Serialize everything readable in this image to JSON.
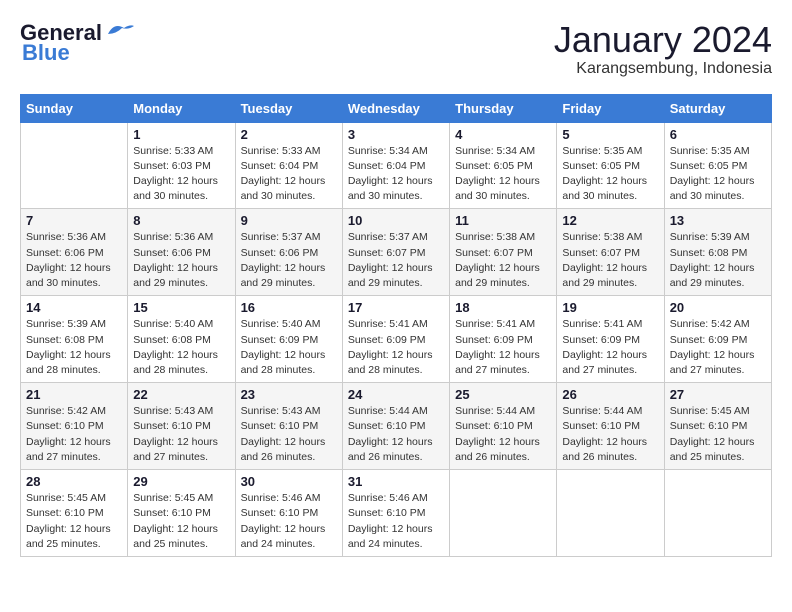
{
  "logo": {
    "general": "General",
    "blue": "Blue",
    "tagline": ""
  },
  "header": {
    "month": "January 2024",
    "location": "Karangsembung, Indonesia"
  },
  "weekdays": [
    "Sunday",
    "Monday",
    "Tuesday",
    "Wednesday",
    "Thursday",
    "Friday",
    "Saturday"
  ],
  "weeks": [
    [
      {
        "day": "",
        "info": ""
      },
      {
        "day": "1",
        "info": "Sunrise: 5:33 AM\nSunset: 6:03 PM\nDaylight: 12 hours\nand 30 minutes."
      },
      {
        "day": "2",
        "info": "Sunrise: 5:33 AM\nSunset: 6:04 PM\nDaylight: 12 hours\nand 30 minutes."
      },
      {
        "day": "3",
        "info": "Sunrise: 5:34 AM\nSunset: 6:04 PM\nDaylight: 12 hours\nand 30 minutes."
      },
      {
        "day": "4",
        "info": "Sunrise: 5:34 AM\nSunset: 6:05 PM\nDaylight: 12 hours\nand 30 minutes."
      },
      {
        "day": "5",
        "info": "Sunrise: 5:35 AM\nSunset: 6:05 PM\nDaylight: 12 hours\nand 30 minutes."
      },
      {
        "day": "6",
        "info": "Sunrise: 5:35 AM\nSunset: 6:05 PM\nDaylight: 12 hours\nand 30 minutes."
      }
    ],
    [
      {
        "day": "7",
        "info": "Sunrise: 5:36 AM\nSunset: 6:06 PM\nDaylight: 12 hours\nand 30 minutes."
      },
      {
        "day": "8",
        "info": "Sunrise: 5:36 AM\nSunset: 6:06 PM\nDaylight: 12 hours\nand 29 minutes."
      },
      {
        "day": "9",
        "info": "Sunrise: 5:37 AM\nSunset: 6:06 PM\nDaylight: 12 hours\nand 29 minutes."
      },
      {
        "day": "10",
        "info": "Sunrise: 5:37 AM\nSunset: 6:07 PM\nDaylight: 12 hours\nand 29 minutes."
      },
      {
        "day": "11",
        "info": "Sunrise: 5:38 AM\nSunset: 6:07 PM\nDaylight: 12 hours\nand 29 minutes."
      },
      {
        "day": "12",
        "info": "Sunrise: 5:38 AM\nSunset: 6:07 PM\nDaylight: 12 hours\nand 29 minutes."
      },
      {
        "day": "13",
        "info": "Sunrise: 5:39 AM\nSunset: 6:08 PM\nDaylight: 12 hours\nand 29 minutes."
      }
    ],
    [
      {
        "day": "14",
        "info": "Sunrise: 5:39 AM\nSunset: 6:08 PM\nDaylight: 12 hours\nand 28 minutes."
      },
      {
        "day": "15",
        "info": "Sunrise: 5:40 AM\nSunset: 6:08 PM\nDaylight: 12 hours\nand 28 minutes."
      },
      {
        "day": "16",
        "info": "Sunrise: 5:40 AM\nSunset: 6:09 PM\nDaylight: 12 hours\nand 28 minutes."
      },
      {
        "day": "17",
        "info": "Sunrise: 5:41 AM\nSunset: 6:09 PM\nDaylight: 12 hours\nand 28 minutes."
      },
      {
        "day": "18",
        "info": "Sunrise: 5:41 AM\nSunset: 6:09 PM\nDaylight: 12 hours\nand 27 minutes."
      },
      {
        "day": "19",
        "info": "Sunrise: 5:41 AM\nSunset: 6:09 PM\nDaylight: 12 hours\nand 27 minutes."
      },
      {
        "day": "20",
        "info": "Sunrise: 5:42 AM\nSunset: 6:09 PM\nDaylight: 12 hours\nand 27 minutes."
      }
    ],
    [
      {
        "day": "21",
        "info": "Sunrise: 5:42 AM\nSunset: 6:10 PM\nDaylight: 12 hours\nand 27 minutes."
      },
      {
        "day": "22",
        "info": "Sunrise: 5:43 AM\nSunset: 6:10 PM\nDaylight: 12 hours\nand 27 minutes."
      },
      {
        "day": "23",
        "info": "Sunrise: 5:43 AM\nSunset: 6:10 PM\nDaylight: 12 hours\nand 26 minutes."
      },
      {
        "day": "24",
        "info": "Sunrise: 5:44 AM\nSunset: 6:10 PM\nDaylight: 12 hours\nand 26 minutes."
      },
      {
        "day": "25",
        "info": "Sunrise: 5:44 AM\nSunset: 6:10 PM\nDaylight: 12 hours\nand 26 minutes."
      },
      {
        "day": "26",
        "info": "Sunrise: 5:44 AM\nSunset: 6:10 PM\nDaylight: 12 hours\nand 26 minutes."
      },
      {
        "day": "27",
        "info": "Sunrise: 5:45 AM\nSunset: 6:10 PM\nDaylight: 12 hours\nand 25 minutes."
      }
    ],
    [
      {
        "day": "28",
        "info": "Sunrise: 5:45 AM\nSunset: 6:10 PM\nDaylight: 12 hours\nand 25 minutes."
      },
      {
        "day": "29",
        "info": "Sunrise: 5:45 AM\nSunset: 6:10 PM\nDaylight: 12 hours\nand 25 minutes."
      },
      {
        "day": "30",
        "info": "Sunrise: 5:46 AM\nSunset: 6:10 PM\nDaylight: 12 hours\nand 24 minutes."
      },
      {
        "day": "31",
        "info": "Sunrise: 5:46 AM\nSunset: 6:10 PM\nDaylight: 12 hours\nand 24 minutes."
      },
      {
        "day": "",
        "info": ""
      },
      {
        "day": "",
        "info": ""
      },
      {
        "day": "",
        "info": ""
      }
    ]
  ]
}
